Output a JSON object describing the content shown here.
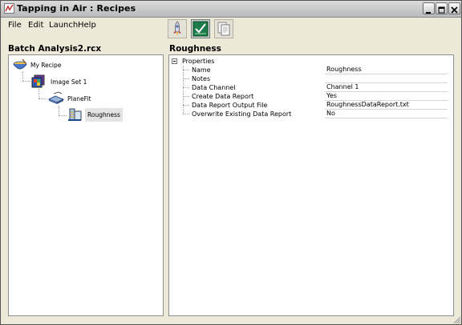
{
  "window": {
    "title": "Tapping in Air : Recipes"
  },
  "menu": {
    "items": [
      "File",
      "Edit",
      "Launch",
      "Help"
    ]
  },
  "toolbar": {
    "buttons": [
      "rocket-icon",
      "checkmark-graph-icon",
      "copy-report-icon"
    ]
  },
  "left_panel": {
    "title": "Batch Analysis2.rcx",
    "tree": [
      "My Recipe",
      "Image Set 1",
      "PlaneFit",
      "Roughness"
    ]
  },
  "right_panel": {
    "title": "Roughness",
    "group": "Properties",
    "properties": [
      {
        "name": "Name",
        "value": "Roughness"
      },
      {
        "name": "Notes",
        "value": ""
      },
      {
        "name": "Data Channel",
        "value": "Channel 1"
      },
      {
        "name": "Create Data Report",
        "value": "Yes"
      },
      {
        "name": "Data Report Output File",
        "value": "RoughnessDataReport.txt"
      },
      {
        "name": "Overwrite Existing Data Report",
        "value": "No"
      }
    ]
  },
  "colors": {
    "titlebar": "#c8c8c8",
    "tree_selection": "#e4e4e4",
    "panel_bg": "#ffffff",
    "window_bg": "#ece9d8"
  }
}
